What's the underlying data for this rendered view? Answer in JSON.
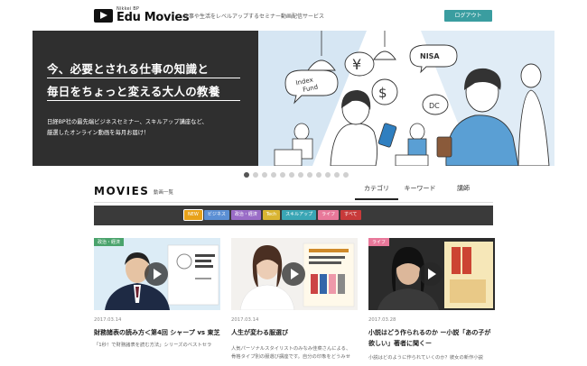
{
  "header": {
    "logo_sub": "Nikkei BP",
    "logo_main": "Edu Movies",
    "tagline": "仕事や生活をレベルアップするセミナー動画配信サービス",
    "logout_label": "ログアウト"
  },
  "hero": {
    "line1": "今、必要とされる仕事の知識と",
    "line2": "毎日をちょっと変える大人の教養",
    "desc1": "日経BP社の最先端ビジネスセミナー、スキルアップ講座など、",
    "desc2": "厳選したオンライン動画を毎月お届け！",
    "bubbles": {
      "nisa": "NISA",
      "index": "Index",
      "fund": "Fund",
      "dc": "DC",
      "yen": "¥",
      "dollar": "$"
    },
    "slide_count": 12,
    "active_slide": 1
  },
  "movies": {
    "title": "MOVIES",
    "subtitle": "動画一覧",
    "tabs": [
      {
        "label": "カテゴリ",
        "active": true
      },
      {
        "label": "キーワード",
        "active": false
      },
      {
        "label": "講師",
        "active": false
      }
    ],
    "categories": [
      {
        "label": "NEW",
        "color": "#e8a21a",
        "selected": true
      },
      {
        "label": "ビジネス",
        "color": "#5b8fd4",
        "selected": false
      },
      {
        "label": "政治・経済",
        "color": "#9a6cc7",
        "selected": false
      },
      {
        "label": "Tech",
        "color": "#d9b532",
        "selected": false
      },
      {
        "label": "スキルアップ",
        "color": "#3aa6b5",
        "selected": false
      },
      {
        "label": "ライフ",
        "color": "#e8789a",
        "selected": false
      },
      {
        "label": "すべて",
        "color": "#c83a3a",
        "selected": false
      }
    ]
  },
  "cards": [
    {
      "badge": "政治・経済",
      "badge_color": "#4aa36c",
      "date": "2017.03.14",
      "title": "財務諸表の読み方＜第4回 シャープ vs 東芝＞",
      "desc": "「1秒！で財務諸表を読む方法」シリーズのベストセラ"
    },
    {
      "badge": "",
      "badge_color": "",
      "date": "2017.03.14",
      "title": "人生が変わる服選び",
      "desc1": "人気パーソナルスタイリストのみなみ佳菜さんによる、",
      "desc2": "骨格タイプ別の服選び講座です。自分の印象をどうみせ"
    },
    {
      "badge": "ライフ",
      "badge_color": "#e8789a",
      "date": "2017.03.28",
      "title1": "小説はどう作られるのか ー小説「あの子が",
      "title2": "欲しい」著者に聞くー",
      "desc": "小説はどのように作られていくのか？彼女の新作小説"
    }
  ]
}
